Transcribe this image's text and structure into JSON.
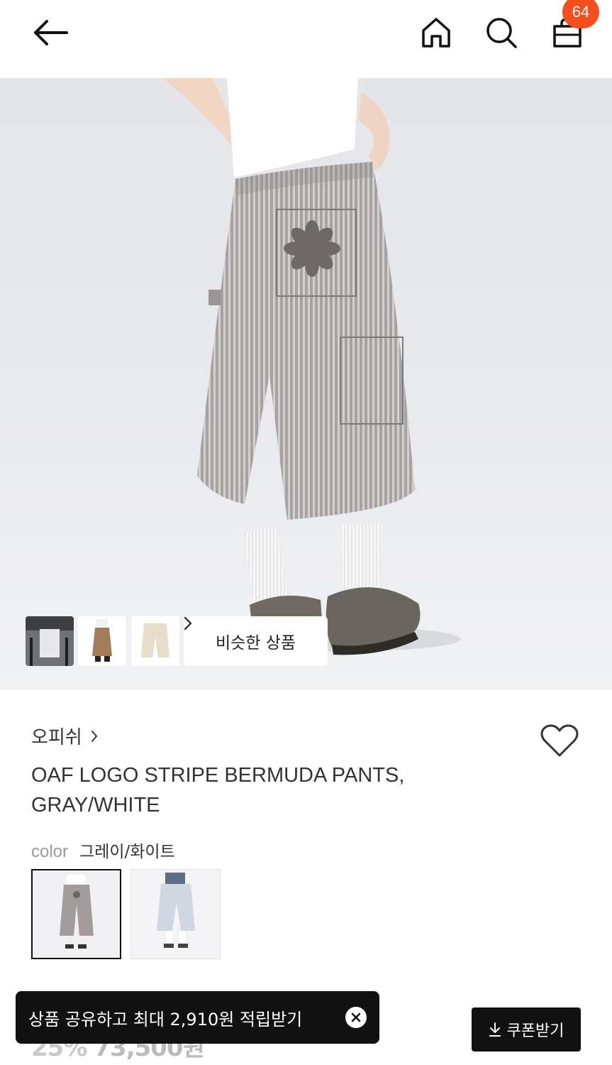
{
  "header": {
    "back_icon": "arrow-left-icon",
    "home_icon": "home-icon",
    "search_icon": "search-icon",
    "cart_icon": "bag-icon",
    "cart_count": "64",
    "badge_color": "#f24e1e"
  },
  "hero": {
    "similar_label": "비슷한 상품",
    "thumbnails": [
      "thumb-1",
      "thumb-2",
      "thumb-3"
    ]
  },
  "product": {
    "brand": "오피쉬",
    "title": "OAF LOGO STRIPE BERMUDA PANTS, GRAY/WHITE",
    "color_label": "color",
    "color_value": "그레이/화이트",
    "price_discount": "25%",
    "price": "73,500원"
  },
  "toast": {
    "text": "상품 공유하고 최대 2,910원 적립받기"
  },
  "coupon": {
    "label": "쿠폰받기"
  }
}
